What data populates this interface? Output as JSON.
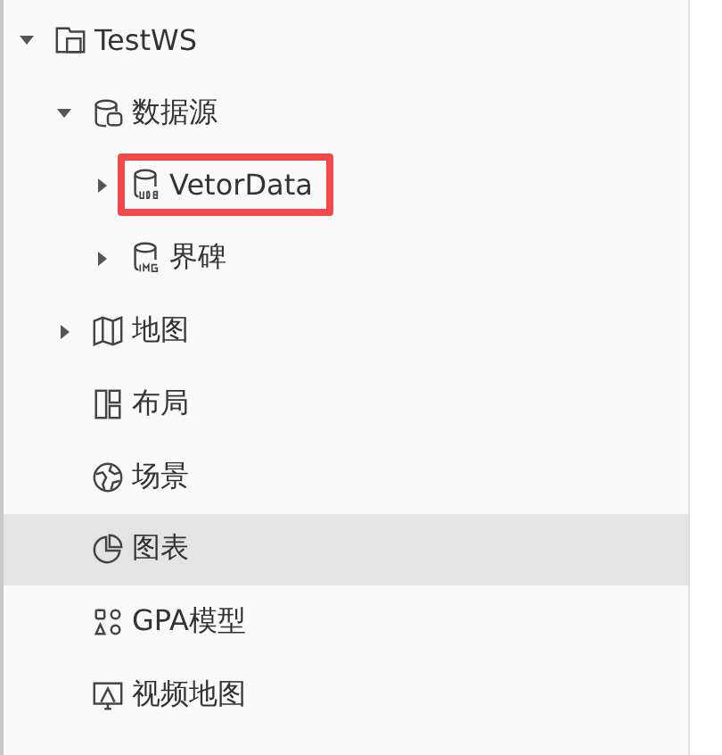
{
  "tree": [
    {
      "label": "TestWS",
      "kind": "workspace",
      "expanded": true,
      "selected": false,
      "children": [
        {
          "label": "数据源",
          "kind": "datasources",
          "expanded": true,
          "selected": false,
          "children": [
            {
              "label": "VetorData",
              "kind": "udb",
              "expanded": false,
              "selected": false,
              "highlighted": true
            },
            {
              "label": "界碑",
              "kind": "img",
              "expanded": false,
              "selected": false
            }
          ]
        },
        {
          "label": "地图",
          "kind": "map",
          "expanded": false,
          "selected": false
        },
        {
          "label": "布局",
          "kind": "layout",
          "selected": false
        },
        {
          "label": "场景",
          "kind": "scene",
          "selected": false
        },
        {
          "label": "图表",
          "kind": "chart",
          "selected": true
        },
        {
          "label": "GPA模型",
          "kind": "model",
          "selected": false
        },
        {
          "label": "视频地图",
          "kind": "video",
          "selected": false
        }
      ]
    }
  ]
}
